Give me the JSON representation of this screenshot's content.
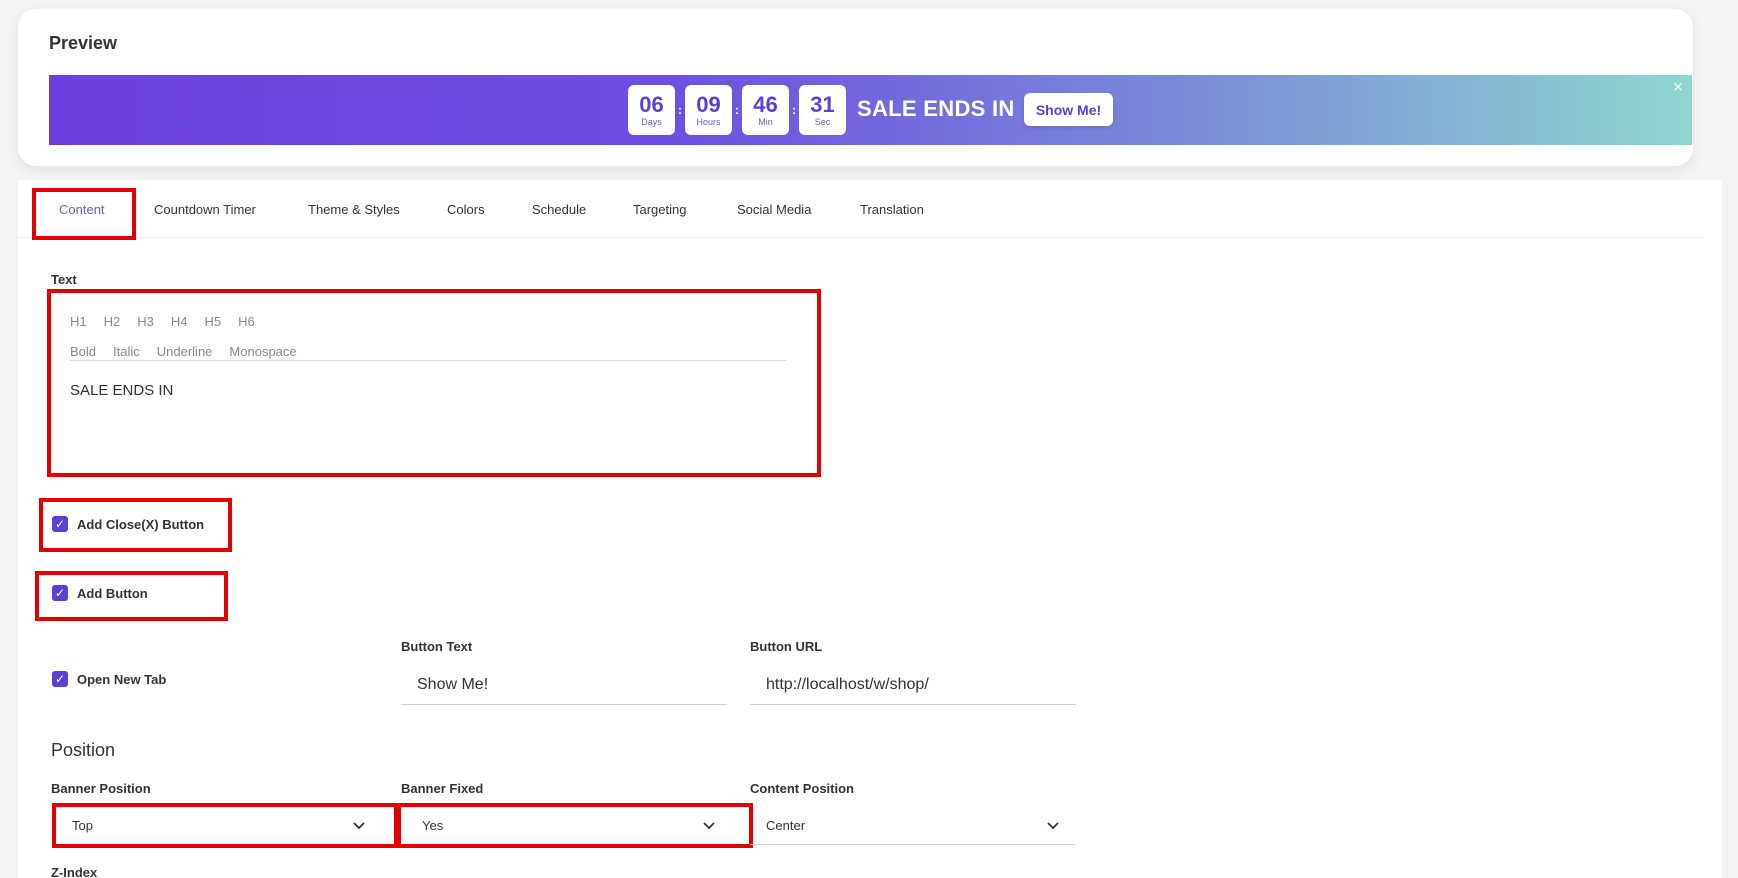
{
  "preview": {
    "title": "Preview",
    "timer": [
      {
        "value": "06",
        "label": "Days"
      },
      {
        "value": "09",
        "label": "Hours"
      },
      {
        "value": "46",
        "label": "Min"
      },
      {
        "value": "31",
        "label": "Sec"
      }
    ],
    "separator": ":",
    "banner_text": "SALE ENDS IN",
    "banner_button": "Show Me!",
    "close_glyph": "×"
  },
  "tabs": [
    {
      "label": "Content",
      "active": true
    },
    {
      "label": "Countdown Timer",
      "active": false
    },
    {
      "label": "Theme & Styles",
      "active": false
    },
    {
      "label": "Colors",
      "active": false
    },
    {
      "label": "Schedule",
      "active": false
    },
    {
      "label": "Targeting",
      "active": false
    },
    {
      "label": "Social Media",
      "active": false
    },
    {
      "label": "Translation",
      "active": false
    }
  ],
  "content": {
    "text_label": "Text",
    "headings": [
      "H1",
      "H2",
      "H3",
      "H4",
      "H5",
      "H6"
    ],
    "formats": [
      "Bold",
      "Italic",
      "Underline",
      "Monospace"
    ],
    "text_value": "SALE ENDS IN",
    "add_close_label": "Add Close(X) Button",
    "add_button_label": "Add Button",
    "open_new_tab_label": "Open New Tab",
    "button_text_label": "Button Text",
    "button_text_value": "Show Me!",
    "button_url_label": "Button URL",
    "button_url_value": "http://localhost/w/shop/",
    "checks": {
      "add_close": true,
      "add_button": true,
      "open_new_tab": true
    }
  },
  "position": {
    "title": "Position",
    "banner_position_label": "Banner Position",
    "banner_position_value": "Top",
    "banner_fixed_label": "Banner Fixed",
    "banner_fixed_value": "Yes",
    "content_position_label": "Content Position",
    "content_position_value": "Center",
    "z_index_label": "Z-Index"
  },
  "colors": {
    "accent": "#5b3fd6",
    "highlight": "#e40000",
    "gradient_start": "#6a3fe0",
    "gradient_end": "#8fd6cf"
  }
}
